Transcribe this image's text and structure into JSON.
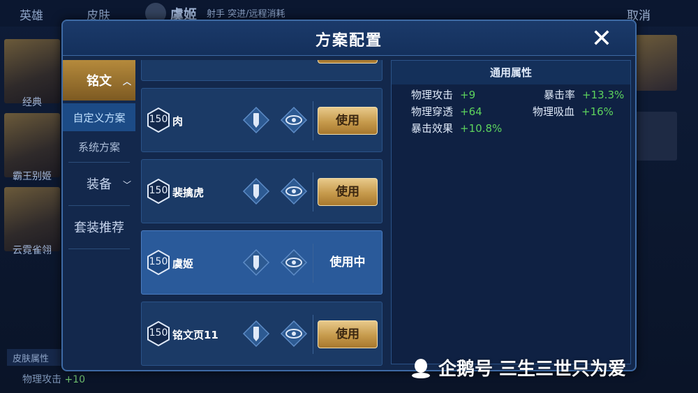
{
  "background": {
    "tabs": [
      "英雄",
      "皮肤"
    ],
    "hero_name": "虞姬",
    "hero_role": "射手 突进/远程消耗",
    "cancel_label": "取消",
    "skins": [
      "经典",
      "霸王别姬",
      "云霓雀翎"
    ],
    "attr_title": "皮肤属性",
    "attr_label": "物理攻击",
    "attr_value": "+10"
  },
  "dialog": {
    "title": "方案配置",
    "close_icon": "close-icon"
  },
  "sidebar": {
    "rune_label": "铭文",
    "custom_plan": "自定义方案",
    "system_plan": "系统方案",
    "equipment_label": "装备",
    "set_recommend": "套装推荐"
  },
  "plans": [
    {
      "level": "150",
      "name": "肉",
      "action": "使用",
      "current": false
    },
    {
      "level": "150",
      "name": "裴擒虎",
      "action": "使用",
      "current": false
    },
    {
      "level": "150",
      "name": "虞姬",
      "action": "使用中",
      "current": true
    },
    {
      "level": "150",
      "name": "铭文页11",
      "action": "使用",
      "current": false
    }
  ],
  "attributes": {
    "title": "通用属性",
    "items": [
      {
        "label": "物理攻击",
        "value": "+9"
      },
      {
        "label": "暴击率",
        "value": "+13.3%"
      },
      {
        "label": "物理穿透",
        "value": "+64"
      },
      {
        "label": "物理吸血",
        "value": "+16%"
      },
      {
        "label": "暴击效果",
        "value": "+10.8%"
      }
    ]
  },
  "watermark": "企鹅号 三生三世只为爱",
  "colors": {
    "accent_gold": "#c69a4c",
    "positive_green": "#5dd35d",
    "panel_blue": "#1b3a66"
  }
}
